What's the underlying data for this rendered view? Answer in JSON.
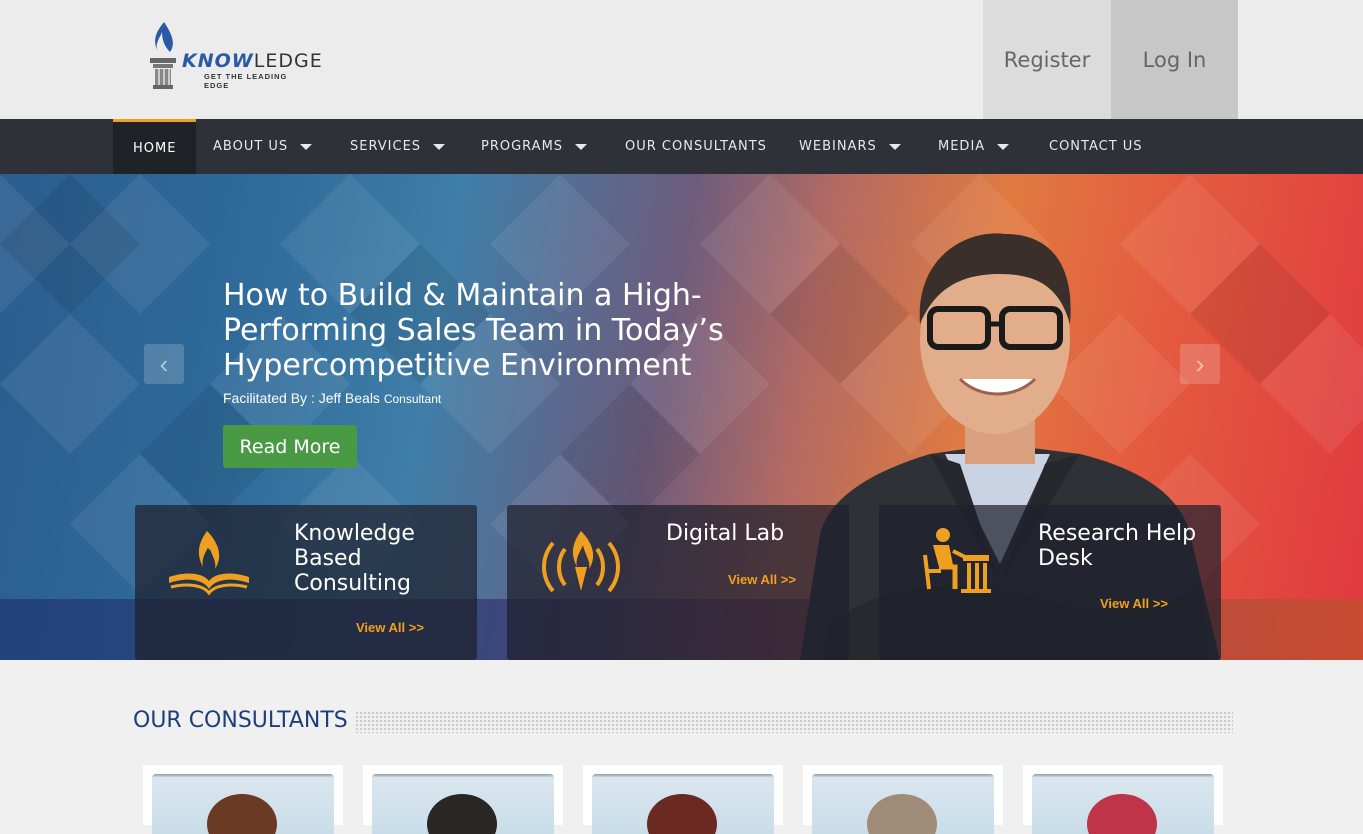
{
  "header": {
    "logo_word_start": "K",
    "logo_word_mid": "NOW",
    "logo_word_end": "LEDGE",
    "logo_tagline": "GET THE LEADING EDGE",
    "register_label": "Register",
    "login_label": "Log In"
  },
  "nav": {
    "items": [
      {
        "label": "HOME"
      },
      {
        "label": "ABOUT US"
      },
      {
        "label": "SERVICES"
      },
      {
        "label": "PROGRAMS"
      },
      {
        "label": "OUR CONSULTANTS"
      },
      {
        "label": "WEBINARS"
      },
      {
        "label": "MEDIA"
      },
      {
        "label": "CONTACT US"
      }
    ]
  },
  "hero": {
    "title": "How to Build & Maintain a High-Performing Sales Team in Today’s Hypercompetitive Environment",
    "facilitated_by": "Facilitated By : Jeff Beals",
    "role": "Consultant",
    "read_more": "Read More",
    "prev_arrow": "‹",
    "next_arrow": "›"
  },
  "cards": [
    {
      "title": "Knowledge Based Consulting",
      "link": "View All >>"
    },
    {
      "title": "Digital Lab",
      "link": "View All >>"
    },
    {
      "title": "Research Help Desk",
      "link": "View All >>"
    }
  ],
  "consultants": {
    "section_title": "OUR CONSULTANTS"
  },
  "colors": {
    "accent": "#f0a020",
    "nav_bg": "#2e3238",
    "button_green": "#4a9a45",
    "section_title": "#1f3f7a"
  }
}
